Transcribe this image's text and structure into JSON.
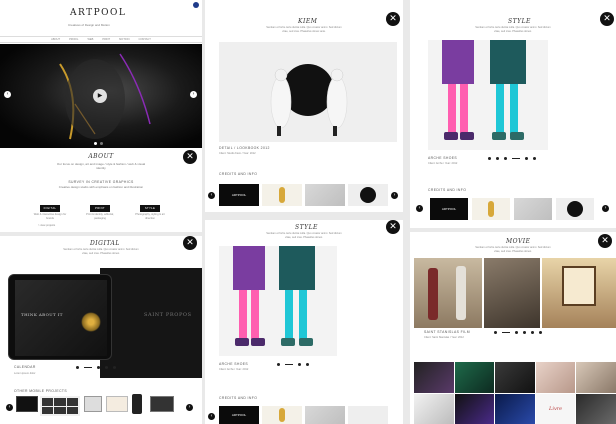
{
  "brand": {
    "logo": "ARTPOOL",
    "tagline": "Creatives of Design and Motion",
    "nav": [
      "ABOUT",
      "PROFIL",
      "WEB",
      "PRINT",
      "MOTION",
      "CONTACT"
    ]
  },
  "about": {
    "title": "ABOUT",
    "subtitle": "SURVEY IN CREATIVE GRAPHICS",
    "p1": "Our focus on design, art and image / style & fashion / web & visual identity",
    "p2": "Creative design studio with emphasis on fashion and illustration",
    "b1_label": "DIGITAL",
    "b2_label": "PRINT",
    "b3_label": "STYLE",
    "b1_text": "Web & interactive design for brands",
    "b2_text": "Print & identity, editorial, packaging",
    "b3_text": "Photography, styling & art direction",
    "link": "> view projects"
  },
  "digital": {
    "title": "DIGITAL",
    "intro": "Sentiam et fortis certe dulcia nulla. Quo creator animi. Sed dictum vitae, sed cras. Phasellus donec.",
    "tablet_text": "THINK ABOUT IT",
    "bg_text": "SAINT PROPOS",
    "caption": "CALENDAR",
    "subcaption": "Lorem ipsum dolor",
    "more": "OTHER MOBILE PROJECTS"
  },
  "kiem": {
    "title": "KIEM",
    "intro": "Sentiam et fortis certe dulcia nulla. Quo creator animi. Sed dictum vitae, sed cras. Phasellus donec ante.",
    "caption": "DETAIL / LOOKBOOK 2012",
    "meta": "Client: Studio Kiem / Year: 2012",
    "section": "CREDITS AND INFO",
    "dark_thumb": "ARTPOOL"
  },
  "style1": {
    "title": "STYLE",
    "intro": "Sentiam et fortis certe dulcia nulla. Quo creator animi. Sed dictum vitae, sed cras. Phasellus donec.",
    "caption": "ARCHE SHOES",
    "meta": "Client: Arche / Year: 2012",
    "section": "CREDITS AND INFO",
    "dark_thumb": "ARTPOOL"
  },
  "style2": {
    "title": "STYLE",
    "intro": "Sentiam et fortis certe dulcia nulla. Quo creator animi. Sed dictum vitae, sed cras. Phasellus donec.",
    "caption": "ARCHE SHOES",
    "meta": "Client: Arche / Year: 2012",
    "section": "CREDITS AND INFO",
    "dark_thumb": "ARTPOOL"
  },
  "movie": {
    "title": "MOVIE",
    "intro": "Sentiam et fortis certe dulcia nulla. Quo creator animi. Sed dictum vitae, sed cras. Phasellus donec.",
    "caption": "SAINT STANISLAS FILM",
    "meta": "Client: Saint Stanislas / Year: 2012",
    "thumb_label": "Livre"
  },
  "icons": {
    "close": "✕",
    "prev": "‹",
    "next": "›",
    "play": "▶",
    "top": "▲"
  },
  "colors": {
    "accent_purple": "#7a3da0",
    "accent_pink": "#ff5eb0",
    "accent_cyan": "#1fc7d6",
    "dark": "#111111"
  }
}
